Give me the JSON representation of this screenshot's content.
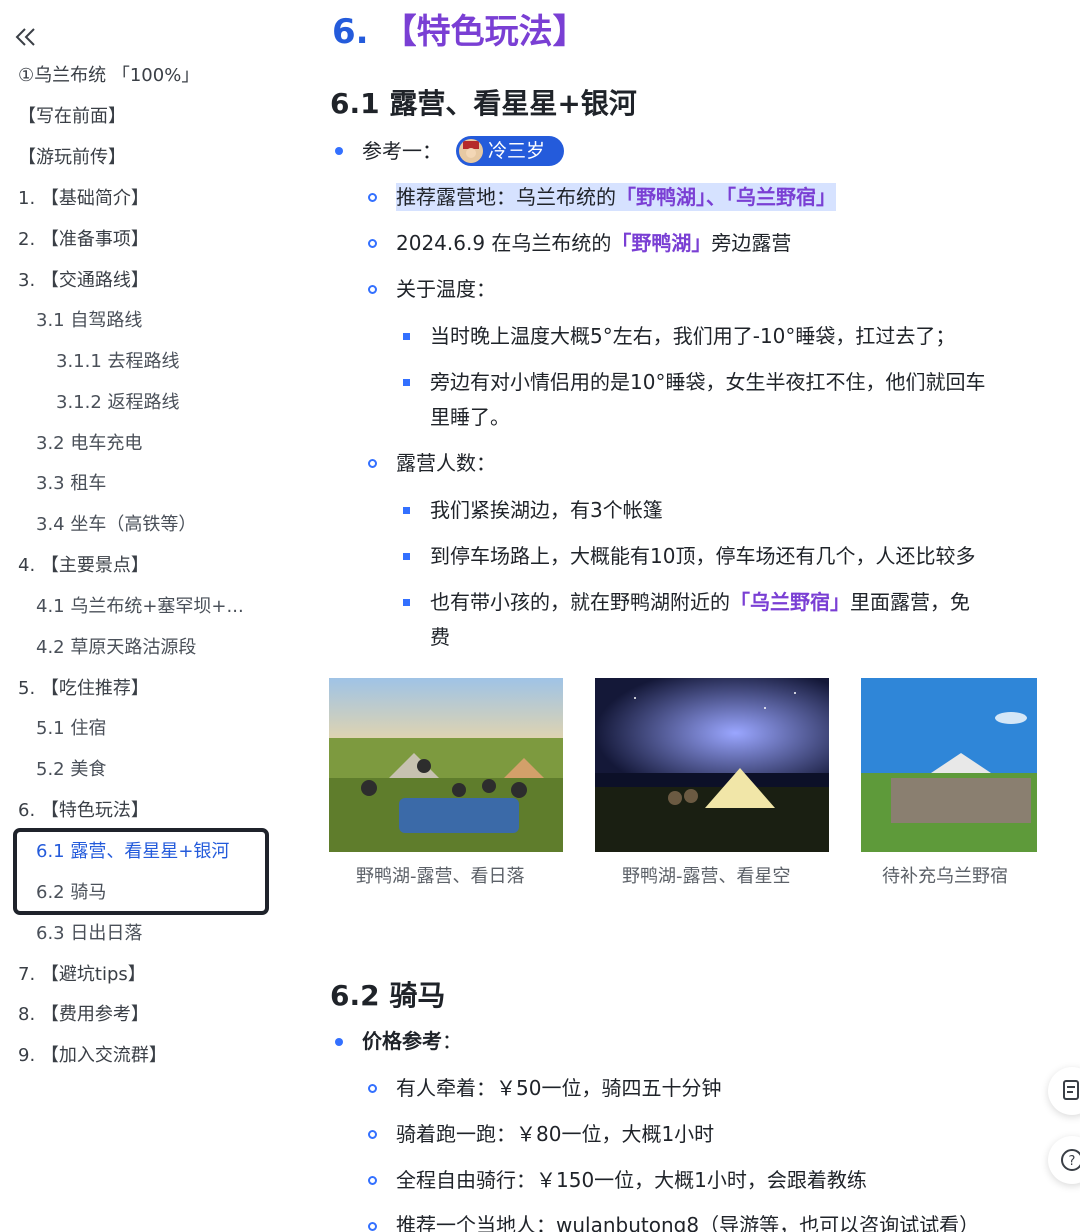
{
  "sidebar": {
    "collapse_icon": "double-chevron-left-icon",
    "items": [
      {
        "label": "①乌兰布统 「100%」",
        "level": 0
      },
      {
        "label": " 【写在前面】",
        "level": 0
      },
      {
        "label": " 【游玩前传】",
        "level": 0
      },
      {
        "label": "1. 【基础简介】",
        "level": 0
      },
      {
        "label": "2. 【准备事项】",
        "level": 0
      },
      {
        "label": "3. 【交通路线】",
        "level": 0
      },
      {
        "label": "3.1 自驾路线",
        "level": 1
      },
      {
        "label": "3.1.1 去程路线",
        "level": 2
      },
      {
        "label": "3.1.2 返程路线",
        "level": 2
      },
      {
        "label": "3.2 电车充电",
        "level": 1
      },
      {
        "label": "3.3 租车",
        "level": 1
      },
      {
        "label": "3.4 坐车（高铁等）",
        "level": 1
      },
      {
        "label": "4. 【主要景点】",
        "level": 0
      },
      {
        "label": "4.1 乌兰布统+塞罕坝+...",
        "level": 1
      },
      {
        "label": "4.2 草原天路沽源段",
        "level": 1
      },
      {
        "label": "5. 【吃住推荐】",
        "level": 0
      },
      {
        "label": "5.1 住宿",
        "level": 1
      },
      {
        "label": "5.2 美食",
        "level": 1
      },
      {
        "label": "6. 【特色玩法】",
        "level": 0
      },
      {
        "label": "6.1 露营、看星星+银河",
        "level": 1,
        "active": true
      },
      {
        "label": "6.2 骑马",
        "level": 1
      },
      {
        "label": "6.3 日出日落",
        "level": 1
      },
      {
        "label": "7. 【避坑tips】",
        "level": 0
      },
      {
        "label": "8. 【费用参考】",
        "level": 0
      },
      {
        "label": "9. 【加入交流群】",
        "level": 0
      }
    ]
  },
  "main": {
    "h1_num": "6.",
    "h1_text": "【特色玩法】",
    "s61": {
      "title": "6.1 露营、看星星+银河",
      "ref_label": "参考一：",
      "mention": "冷三岁",
      "rec_prefix": "推荐露营地：乌兰布统的",
      "rec_hl1": "「野鸭湖」",
      "rec_sep": "、",
      "rec_hl2": "「乌兰野宿」",
      "date_prefix": "2024.6.9 在乌兰布统的",
      "date_hl": "「野鸭湖」",
      "date_suffix": "旁边露营",
      "temp_label": "关于温度：",
      "temp_1": "当时晚上温度大概5°左右，我们用了-10°睡袋，扛过去了；",
      "temp_2a": "旁边有对小情侣用的是10°睡袋，女生半夜扛不住，他们就回车",
      "temp_2b": "里睡了。",
      "people_label": "露营人数：",
      "people_1": "我们紧挨湖边，有3个帐篷",
      "people_2": "到停车场路上，大概能有10顶，停车场还有几个，人还比较多",
      "people_3_prefix": "也有带小孩的，就在野鸭湖附近的",
      "people_3_hl": "「乌兰野宿」",
      "people_3_suffix": "里面露营，免",
      "people_3b": "费",
      "captions": [
        "野鸭湖-露营、看日落",
        "野鸭湖-露营、看星空",
        "待补充乌兰野宿"
      ]
    },
    "s62": {
      "title": "6.2 骑马",
      "price_label": "价格参考",
      "price_colon": "：",
      "p1": "有人牵着：￥50一位，骑四五十分钟",
      "p2": "骑着跑一跑：￥80一位，大概1小时",
      "p3": "全程自由骑行：￥150一位，大概1小时，会跟着教练",
      "p4": "推荐一个当地人：wulanbutong8（导游等，也可以咨询试试看）"
    }
  },
  "float_buttons": [
    "document-icon",
    "help-icon"
  ],
  "colors": {
    "accent_blue": "#245bdb",
    "highlight_purple": "#7a3fd4",
    "bullet_blue": "#3370ff",
    "mark_bg": "#d6e2ff"
  }
}
